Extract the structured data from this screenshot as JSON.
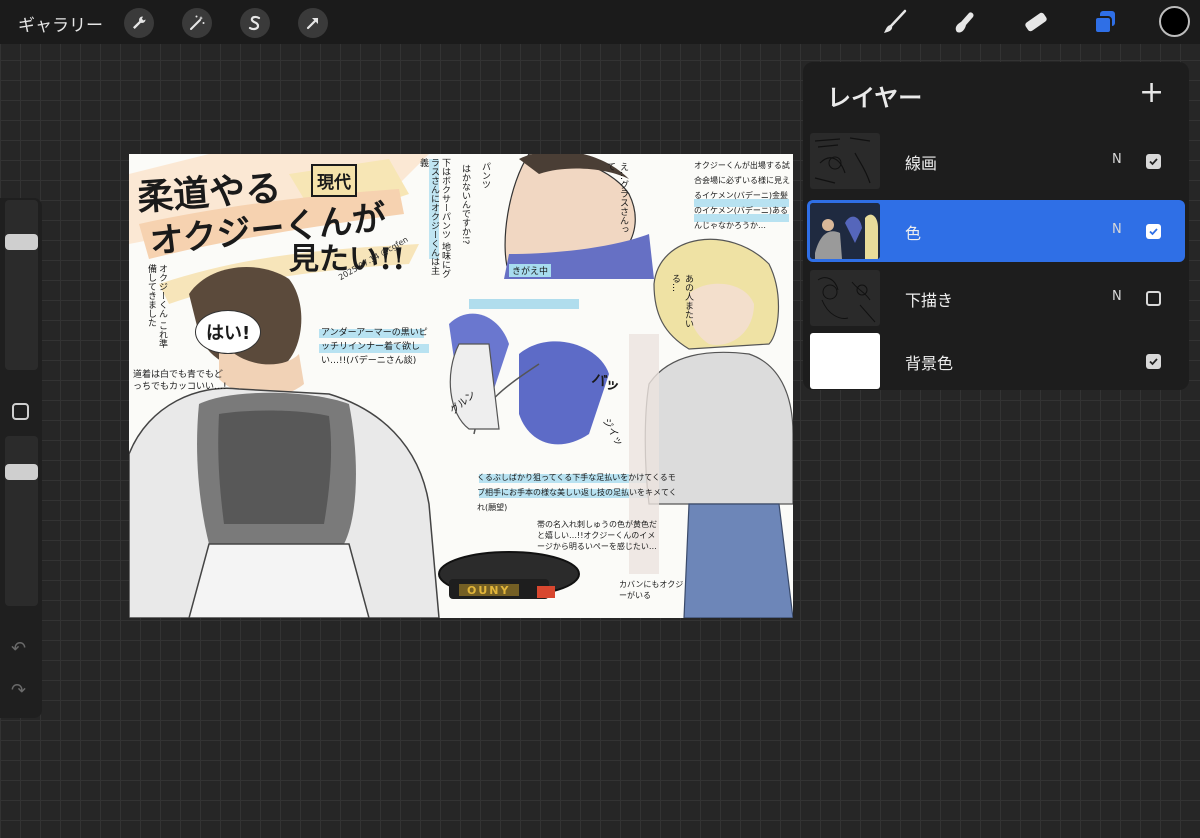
{
  "toolbar": {
    "gallery_label": "ギャラリー",
    "left_tools": [
      "wrench-icon",
      "magic-wand-icon",
      "selection-s-icon",
      "arrow-icon"
    ],
    "right_tools": [
      "brush-icon",
      "smudge-icon",
      "eraser-icon",
      "layers-icon"
    ],
    "current_color": "#000000",
    "accent_color": "#2f6fe6"
  },
  "sidebar": {
    "brush_size_level": 0.78,
    "opacity_level": 0.82,
    "undo_icon": "undo-icon",
    "redo_icon": "redo-icon"
  },
  "canvas": {
    "artwork": {
      "title_line1": "柔道やる",
      "title_badge": "現代",
      "title_line2": "オクジーくんが",
      "title_line3": "見たい!!",
      "speech_hai": "はい!",
      "speech_left": "オクジーくん これ準備してきました",
      "note_left": "道着は白でも青でもどっちでもカッコいい…!",
      "note_blue": "アンダーアーマーの黒いピッチリインナー着て欲しい…!!(バデーニさん談)",
      "note_top": "下はボクサーパンツ 地味にグラスさんにオクジーくんは主義",
      "speech_pants": "パンツ",
      "speech_hakanai": "はかないんですか!?",
      "speech_grass": "え…グラスさんって",
      "label_kigae": "きがえ中",
      "note_throw": "くるぶしばかり狙ってくる下手な足払いをかけてくるモブ相手にお手本の様な美しい返し技の足払いをキメてくれ(願望)",
      "note_belt": "帯の名入れ刺しゅうの色が黄色だと嬉しい…!!オクジーくんのイメージから明るいぺーを感じたい…",
      "note_right": "オクジーくんが出場する試合会場に必ずいる様に見えるイケメン(バデーニ)金髪のイケメン(バデーニ)あるんじゃなかろうか…",
      "speech_right": "あの人またいる…",
      "note_bottom_right": "カバンにもオクジーがいる",
      "belt_text": "OUNY",
      "signature": "2025.07.14 @cgfen",
      "sfx": [
        "バッ",
        "グルン",
        "ジイッ"
      ]
    }
  },
  "layers_panel": {
    "title": "レイヤー",
    "add_icon": "plus-icon",
    "layers": [
      {
        "name": "線画",
        "blend": "N",
        "visible": true,
        "active": false
      },
      {
        "name": "色",
        "blend": "N",
        "visible": true,
        "active": true
      },
      {
        "name": "下描き",
        "blend": "N",
        "visible": false,
        "active": false
      },
      {
        "name": "背景色",
        "blend": "",
        "visible": true,
        "active": false
      }
    ]
  }
}
